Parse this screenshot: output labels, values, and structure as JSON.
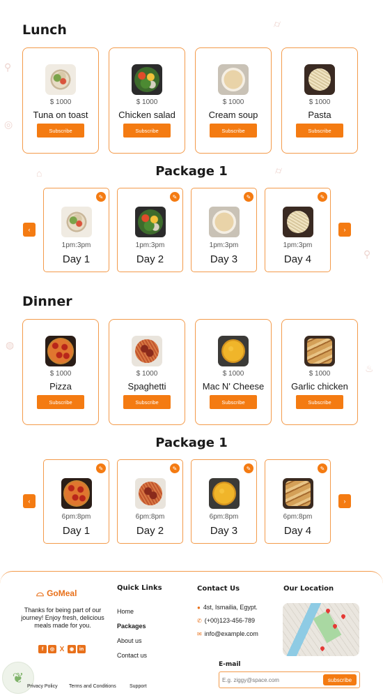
{
  "lunch": {
    "title": "Lunch",
    "items": [
      {
        "name": "Tuna on toast",
        "price": "$ 1000",
        "button": "Subscribe",
        "img": "tuna"
      },
      {
        "name": "Chicken salad",
        "price": "$ 1000",
        "button": "Subscribe",
        "img": "salad"
      },
      {
        "name": "Cream soup",
        "price": "$ 1000",
        "button": "Subscribe",
        "img": "soup"
      },
      {
        "name": "Pasta",
        "price": "$ 1000",
        "button": "Subscribe",
        "img": "pasta"
      }
    ],
    "package": {
      "title": "Package 1",
      "days": [
        {
          "day": "Day 1",
          "time": "1pm:3pm",
          "img": "tuna"
        },
        {
          "day": "Day 2",
          "time": "1pm:3pm",
          "img": "salad"
        },
        {
          "day": "Day 3",
          "time": "1pm:3pm",
          "img": "soup"
        },
        {
          "day": "Day 4",
          "time": "1pm:3pm",
          "img": "pasta"
        }
      ]
    }
  },
  "dinner": {
    "title": "Dinner",
    "items": [
      {
        "name": "Pizza",
        "price": "$ 1000",
        "button": "Subscribe",
        "img": "pizza"
      },
      {
        "name": "Spaghetti",
        "price": "$ 1000",
        "button": "Subscribe",
        "img": "spag"
      },
      {
        "name": "Mac N' Cheese",
        "price": "$ 1000",
        "button": "Subscribe",
        "img": "mac"
      },
      {
        "name": "Garlic chicken",
        "price": "$ 1000",
        "button": "Subscribe",
        "img": "garlic"
      }
    ],
    "package": {
      "title": "Package 1",
      "days": [
        {
          "day": "Day 1",
          "time": "6pm:8pm",
          "img": "pizza"
        },
        {
          "day": "Day 2",
          "time": "6pm:8pm",
          "img": "spag"
        },
        {
          "day": "Day 3",
          "time": "6pm:8pm",
          "img": "mac"
        },
        {
          "day": "Day 4",
          "time": "6pm:8pm",
          "img": "garlic"
        }
      ]
    }
  },
  "footer": {
    "brand": "GoMeal",
    "tagline": "Thanks for being part of our journey! Enjoy fresh, delicious meals made for you.",
    "social_icons": [
      "facebook-icon",
      "instagram-icon",
      "x-icon",
      "github-icon",
      "linkedin-icon"
    ],
    "quick_links_title": "Quick Links",
    "quick_links": [
      "Home",
      "Packages",
      "About us",
      "Contact us"
    ],
    "contact_title": "Contact Us",
    "address": "4st, Ismailia, Egypt.",
    "phone": "(+00)123-456-789",
    "email": "info@example.com",
    "location_title": "Our Location",
    "email_label": "E-mail",
    "email_placeholder": "E.g. ziggy@space.com",
    "subscribe_label": "subscribe",
    "bottom_links": [
      "Privacy Policy",
      "Terms and Conditions",
      "Support"
    ]
  },
  "colors": {
    "accent": "#f47b12",
    "border": "#f39a4a"
  }
}
